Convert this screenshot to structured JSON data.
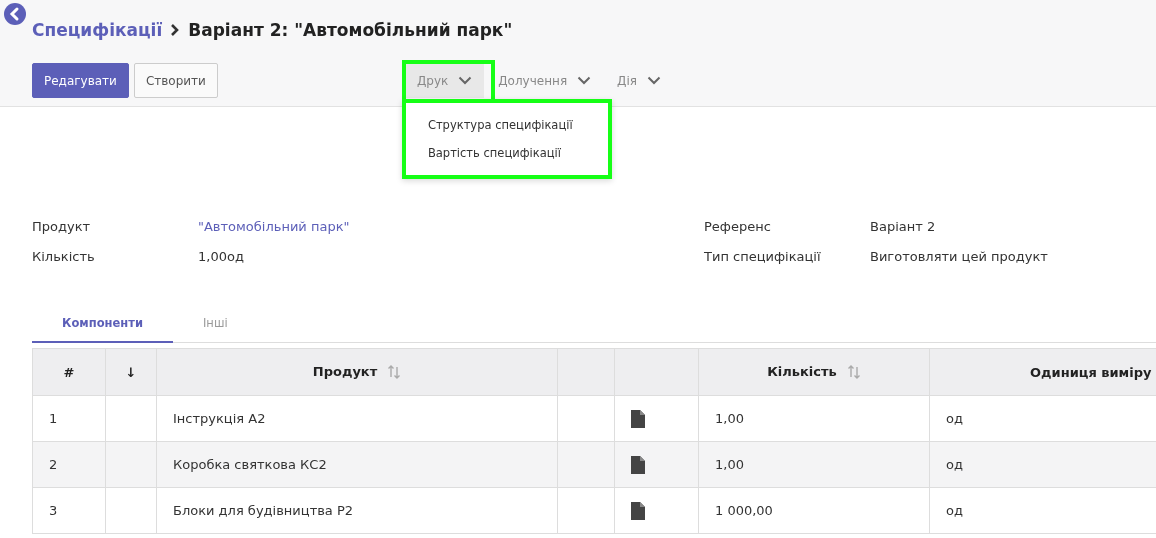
{
  "breadcrumb": {
    "parent": "Специфікації",
    "current": "Варіант 2: \"Автомобільний парк\""
  },
  "buttons": [
    {
      "label": "Редагувати",
      "kind": "primary"
    },
    {
      "label": "Створити",
      "kind": "secondary"
    }
  ],
  "menus": [
    {
      "label": "Друк",
      "expanded": true,
      "items": [
        "Структура специфікації",
        "Вартість специфікації"
      ]
    },
    {
      "label": "Долучення",
      "expanded": false
    },
    {
      "label": "Дія",
      "expanded": false
    }
  ],
  "fields_left": [
    {
      "label": "Продукт",
      "value": "\"Автомобільний парк\"",
      "kind": "link"
    },
    {
      "label": "Кількість",
      "value": "1,00од",
      "kind": "text"
    }
  ],
  "fields_right": [
    {
      "label": "Референс",
      "value": "Варіант 2"
    },
    {
      "label": "Тип специфікації",
      "value": "Виготовляти цей продукт"
    }
  ],
  "tabs": [
    {
      "label": "Компоненти",
      "selected": true
    },
    {
      "label": "Інші",
      "selected": false
    }
  ],
  "table": {
    "columns": [
      {
        "label": "#",
        "sortable": false,
        "kind": "text"
      },
      {
        "label": "↓",
        "sortable": false,
        "kind": "text"
      },
      {
        "label": "Продукт",
        "sortable": true,
        "kind": "text"
      },
      {
        "sortable": false,
        "kind": "empty"
      },
      {
        "sortable": false,
        "kind": "icon"
      },
      {
        "label": "Кількість",
        "sortable": true,
        "kind": "text"
      },
      {
        "label": "Одиниця виміру",
        "sortable": false,
        "kind": "text"
      }
    ],
    "rows": [
      {
        "number": "1",
        "product": "Інструкція A2",
        "quantity": "1,00",
        "uom": "од"
      },
      {
        "number": "2",
        "product": "Коробка святкова КС2",
        "quantity": "1,00",
        "uom": "од"
      },
      {
        "number": "3",
        "product": "Блоки для будівництва P2",
        "quantity": "1 000,00",
        "uom": "од"
      }
    ]
  }
}
